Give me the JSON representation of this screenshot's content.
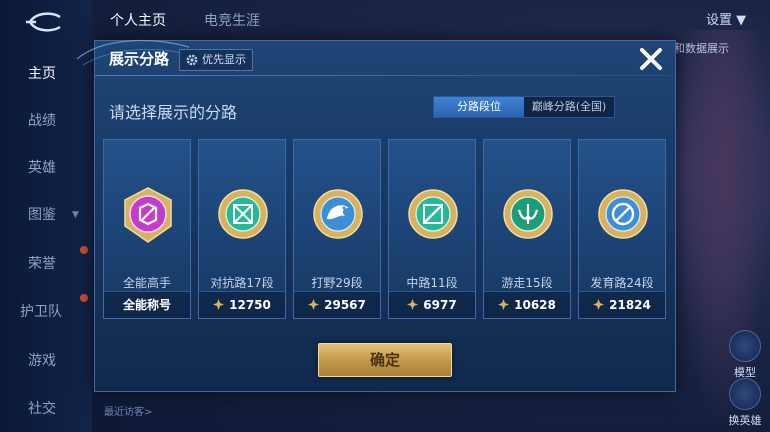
{
  "nav": {
    "items": [
      {
        "label": "主页"
      },
      {
        "label": "战绩"
      },
      {
        "label": "英雄"
      },
      {
        "label": "图鉴"
      },
      {
        "label": "荣誉"
      },
      {
        "label": "护卫队"
      },
      {
        "label": "游戏"
      },
      {
        "label": "社交"
      }
    ]
  },
  "header": {
    "tabs": [
      {
        "label": "个人主页"
      },
      {
        "label": "电竞生涯"
      }
    ],
    "settings_label": "设置",
    "data_show_label": "和数据展示"
  },
  "right_panel": {
    "model_label": "模型",
    "swap_label": "换英雄"
  },
  "visitors_label": "最近访客>",
  "dialog": {
    "title": "展示分路",
    "priority_label": "优先显示",
    "prompt": "请选择展示的分路",
    "toggle": {
      "options": [
        "分路段位",
        "巅峰分路(全国)"
      ],
      "selected": "分路段位"
    },
    "cards": [
      {
        "label": "全能高手",
        "value": "全能称号",
        "emblem": "all-rounder-emblem",
        "color": "#c43cc9"
      },
      {
        "label": "对抗路17段",
        "value": "12750",
        "emblem": "clash-lane-emblem",
        "color": "#27b89a"
      },
      {
        "label": "打野29段",
        "value": "29567",
        "emblem": "jungle-emblem",
        "color": "#3a8fd8"
      },
      {
        "label": "中路11段",
        "value": "6977",
        "emblem": "mid-lane-emblem",
        "color": "#27b89a"
      },
      {
        "label": "游走15段",
        "value": "10628",
        "emblem": "roam-emblem",
        "color": "#1f9c78"
      },
      {
        "label": "发育路24段",
        "value": "21824",
        "emblem": "farm-lane-emblem",
        "color": "#3a8fd8"
      }
    ],
    "confirm_label": "确定"
  },
  "colors": {
    "gold": "#d8b25e",
    "dialog_bg": "#1f4576",
    "accent_blue": "#3d83d6"
  }
}
